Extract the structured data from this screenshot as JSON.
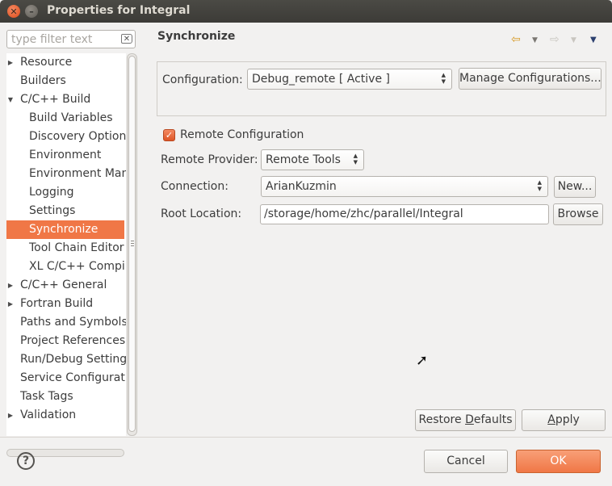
{
  "window": {
    "title": "Properties for Integral"
  },
  "filter": {
    "placeholder": "type filter text"
  },
  "tree": {
    "items": [
      {
        "label": "Resource",
        "expander": "▶"
      },
      {
        "label": "Builders",
        "expander": ""
      },
      {
        "label": "C/C++ Build",
        "expander": "▼"
      },
      {
        "label": "Build Variables",
        "expander": ""
      },
      {
        "label": "Discovery Options",
        "expander": ""
      },
      {
        "label": "Environment",
        "expander": ""
      },
      {
        "label": "Environment Man",
        "expander": ""
      },
      {
        "label": "Logging",
        "expander": ""
      },
      {
        "label": "Settings",
        "expander": ""
      },
      {
        "label": "Synchronize",
        "expander": "",
        "selected": true
      },
      {
        "label": "Tool Chain Editor",
        "expander": ""
      },
      {
        "label": "XL C/C++ Compile",
        "expander": ""
      },
      {
        "label": "C/C++ General",
        "expander": "▶"
      },
      {
        "label": "Fortran Build",
        "expander": "▶"
      },
      {
        "label": "Paths and Symbols",
        "expander": ""
      },
      {
        "label": "Project References",
        "expander": ""
      },
      {
        "label": "Run/Debug Settings",
        "expander": ""
      },
      {
        "label": "Service Configuratio",
        "expander": ""
      },
      {
        "label": "Task Tags",
        "expander": ""
      },
      {
        "label": "Validation",
        "expander": "▶"
      }
    ]
  },
  "page": {
    "title": "Synchronize",
    "nav": {
      "back_icon": "⇦",
      "forward_icon": "⇨",
      "dropdown_icon": "▼",
      "menu_icon": "▼"
    },
    "configuration": {
      "label": "Configuration:",
      "value": "Debug_remote  [ Active ]",
      "manage_button": "Manage Configurations..."
    },
    "remote_config": {
      "checkbox_label": "Remote Configuration",
      "checked": true,
      "check_glyph": "✓"
    },
    "remote_provider": {
      "label": "Remote Provider:",
      "value": "Remote Tools"
    },
    "connection": {
      "label": "Connection:",
      "value": "ArianKuzmin",
      "new_button": "New..."
    },
    "root_location": {
      "label": "Root Location:",
      "value": "/storage/home/zhc/parallel/Integral",
      "browse_button": "Browse"
    },
    "restore_defaults_prefix": "Restore ",
    "restore_defaults_mnemonic": "D",
    "restore_defaults_suffix": "efaults",
    "apply_mnemonic": "A",
    "apply_suffix": "pply"
  },
  "footer": {
    "help_icon": "?",
    "cancel_button": "Cancel",
    "ok_button": "OK"
  },
  "colors": {
    "accent": "#f07746",
    "selection_text": "#ffffff",
    "window_bg": "#f2f1f0"
  }
}
